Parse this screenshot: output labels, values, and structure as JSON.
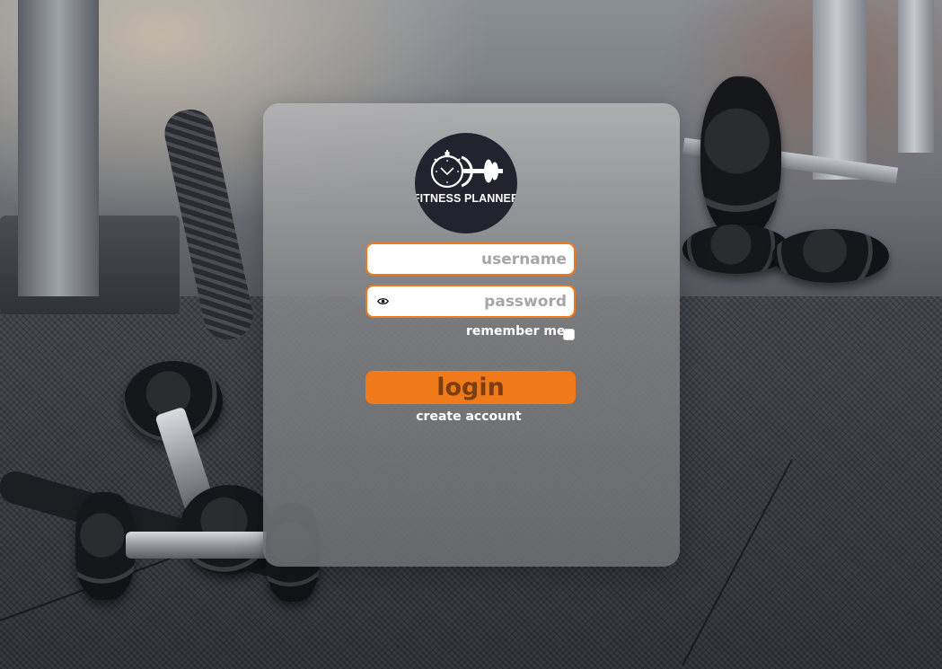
{
  "logo": {
    "text": "FITNESS PLANNER",
    "icon": "stopwatch-barbell-icon",
    "background": "#23222f"
  },
  "login_form": {
    "username": {
      "placeholder": "username",
      "value": ""
    },
    "password": {
      "placeholder": "password",
      "value": "",
      "icon": "eye-icon"
    },
    "remember_me": {
      "label": "remember me",
      "checked": false
    },
    "submit_label": "login",
    "create_account_label": "create account"
  },
  "colors": {
    "accent": "#f07a1a",
    "button_text": "#7a3e12",
    "card": "#8a8a8d"
  }
}
